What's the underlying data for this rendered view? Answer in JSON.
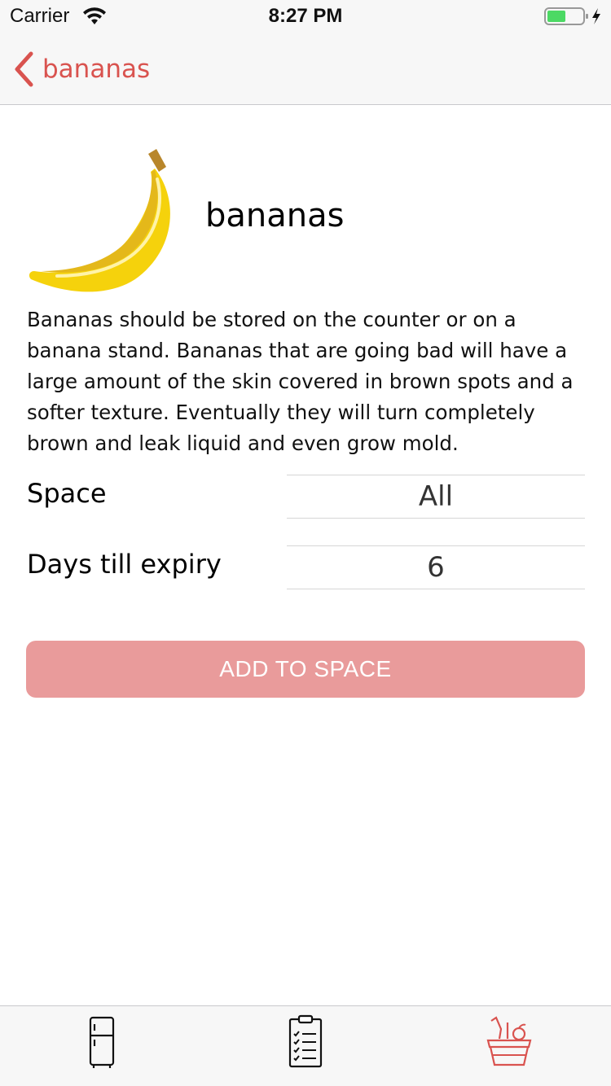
{
  "status_bar": {
    "carrier": "Carrier",
    "time": "8:27 PM",
    "battery_color": "#4cd964"
  },
  "nav": {
    "back_label": "bananas",
    "accent_color": "#d9534f"
  },
  "item": {
    "title": "bananas",
    "image_icon": "banana-icon",
    "description": "Bananas should be stored on the counter or on a banana stand.  Bananas that are going bad will have a large amount of the skin covered in brown spots and a softer texture.  Eventually they will turn completely brown and leak liquid and even grow mold."
  },
  "fields": {
    "space": {
      "label": "Space",
      "value": "All"
    },
    "expiry": {
      "label": "Days till expiry",
      "value": "6"
    }
  },
  "actions": {
    "add_label": "ADD TO SPACE",
    "add_color": "#e99b9b"
  },
  "tab_bar": {
    "tabs": [
      {
        "icon": "fridge-icon",
        "active": false
      },
      {
        "icon": "checklist-icon",
        "active": false
      },
      {
        "icon": "basket-icon",
        "active": true
      }
    ],
    "active_color": "#d9534f"
  }
}
